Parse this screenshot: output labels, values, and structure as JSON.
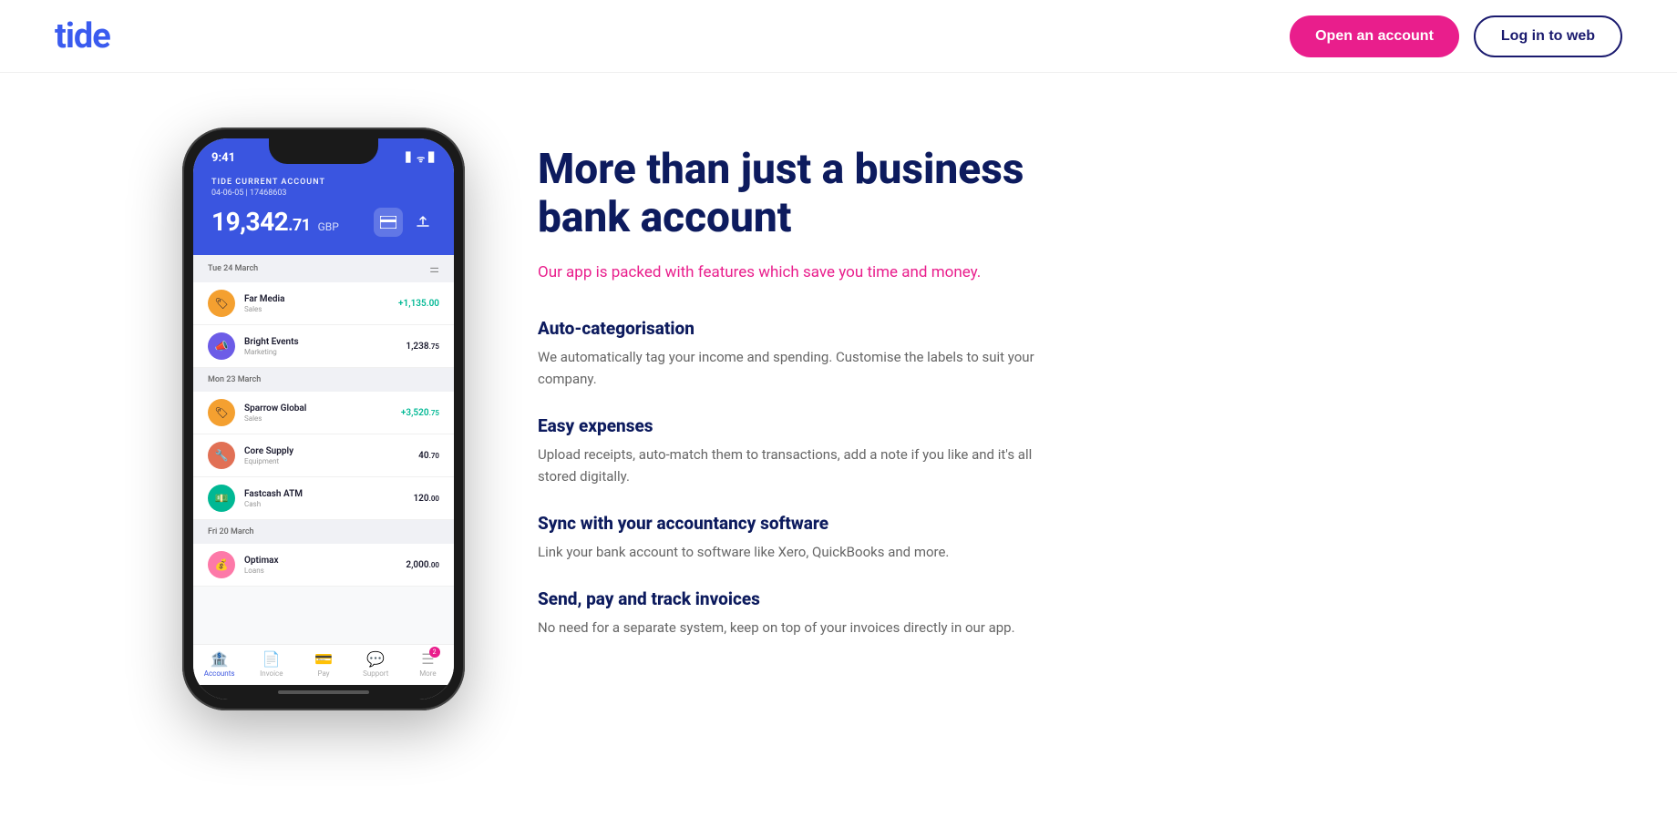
{
  "header": {
    "logo": "tide",
    "open_account_label": "Open an account",
    "login_label": "Log in to web"
  },
  "phone": {
    "time": "9:41",
    "signal_icons": "▋ ᯤ ▊",
    "account_label": "TIDE CURRENT ACCOUNT",
    "account_number": "04-06-05 | 17468603",
    "balance_main": "19,342",
    "balance_decimal": ".71",
    "balance_currency": "GBP",
    "date_headers": [
      "Tue 24 March",
      "Mon 23 March",
      "Fri 20 March"
    ],
    "transactions": [
      {
        "name": "Far Media",
        "category": "Sales",
        "amount": "+1,135.00",
        "positive": true,
        "icon_bg": "#f4a030",
        "icon": "🏷"
      },
      {
        "name": "Bright Events",
        "category": "Marketing",
        "amount": "1,238.75",
        "positive": false,
        "icon_bg": "#6c5ce7",
        "icon": "📣"
      },
      {
        "name": "Sparrow Global",
        "category": "Sales",
        "amount": "+3,520.75",
        "positive": true,
        "icon_bg": "#f4a030",
        "icon": "🏷"
      },
      {
        "name": "Core Supply",
        "category": "Equipment",
        "amount": "40.70",
        "positive": false,
        "icon_bg": "#e17055",
        "icon": "🔧"
      },
      {
        "name": "Fastcash ATM",
        "category": "Cash",
        "amount": "120.00",
        "positive": false,
        "icon_bg": "#00b894",
        "icon": "💵"
      },
      {
        "name": "Optimax",
        "category": "Loans",
        "amount": "2,000.00",
        "positive": false,
        "icon_bg": "#fd79a8",
        "icon": "💰"
      }
    ],
    "nav": [
      {
        "label": "Accounts",
        "active": true,
        "icon": "🏦"
      },
      {
        "label": "Invoice",
        "active": false,
        "icon": "📄"
      },
      {
        "label": "Pay",
        "active": false,
        "icon": "💳"
      },
      {
        "label": "Support",
        "active": false,
        "icon": "💬"
      },
      {
        "label": "More",
        "active": false,
        "icon": "☰",
        "badge": "2"
      }
    ]
  },
  "content": {
    "hero_title": "More than just a business bank account",
    "hero_subtitle_plain": "Our app is packed with features which save you time and ",
    "hero_subtitle_highlight": "money",
    "hero_subtitle_end": ".",
    "features": [
      {
        "title": "Auto-categorisation",
        "description": "We automatically tag your income and spending. Customise the labels to suit your company."
      },
      {
        "title": "Easy expenses",
        "description": "Upload receipts, auto-match them to transactions, add a note if you like and it's all stored digitally."
      },
      {
        "title": "Sync with your accountancy software",
        "description": "Link your bank account to software like Xero, QuickBooks and more."
      },
      {
        "title": "Send, pay and track invoices",
        "description": "No need for a separate system, keep on top of your invoices directly in our app."
      }
    ]
  }
}
